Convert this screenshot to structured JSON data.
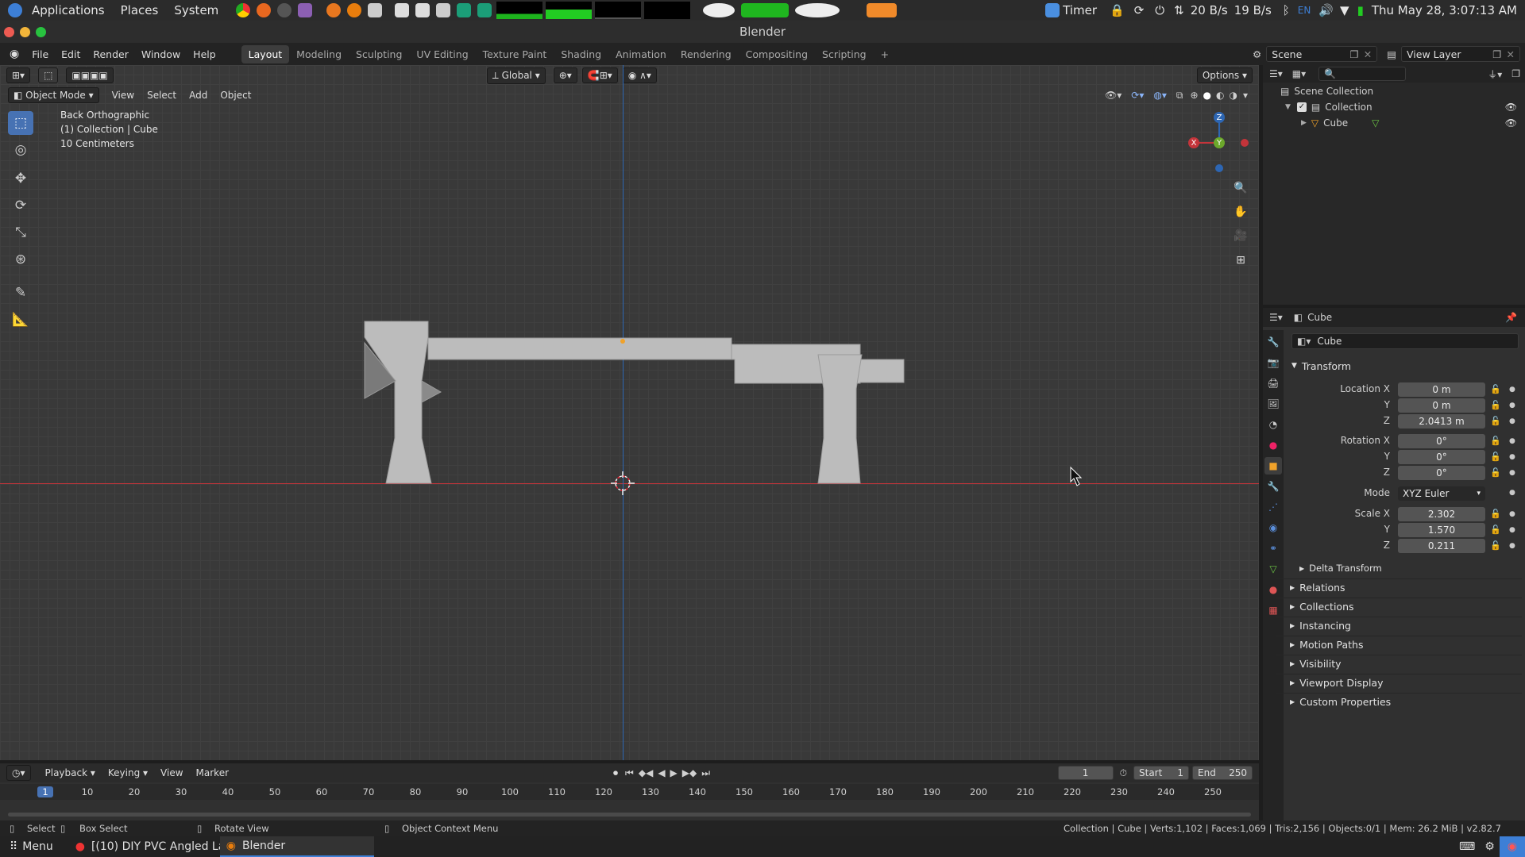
{
  "system_panel": {
    "menus": [
      "Applications",
      "Places",
      "System"
    ],
    "timer_label": "Timer",
    "net_down": "20 B/s",
    "net_up": "19 B/s",
    "lang": "EN",
    "datetime": "Thu May 28, 3:07:13 AM"
  },
  "window": {
    "title": "Blender"
  },
  "topbar": {
    "menus": [
      "File",
      "Edit",
      "Render",
      "Window",
      "Help"
    ],
    "workspaces": [
      "Layout",
      "Modeling",
      "Sculpting",
      "UV Editing",
      "Texture Paint",
      "Shading",
      "Animation",
      "Rendering",
      "Compositing",
      "Scripting"
    ],
    "active_workspace": "Layout",
    "add_tab": "+",
    "scene_label": "Scene",
    "view_layer_label": "View Layer"
  },
  "viewport": {
    "mode": "Object Mode",
    "menus": [
      "View",
      "Select",
      "Add",
      "Object"
    ],
    "orientation": "Global",
    "options": "Options",
    "overlay": {
      "view_name": "Back Orthographic",
      "collection_info": "(1) Collection | Cube",
      "grid_scale": "10 Centimeters"
    },
    "gizmo": {
      "x": "X",
      "y": "Y",
      "z": "Z"
    },
    "colors": {
      "background": "#393939",
      "x_axis": "#c4343a",
      "z_axis": "#2d66b3",
      "mesh": "#bcbcbc"
    }
  },
  "outliner": {
    "search_placeholder": "",
    "items": [
      {
        "label": "Scene Collection"
      },
      {
        "label": "Collection"
      },
      {
        "label": "Cube"
      }
    ]
  },
  "properties": {
    "header_object": "Cube",
    "object_name": "Cube",
    "transform_label": "Transform",
    "location": {
      "label_x": "Location X",
      "label_y": "Y",
      "label_z": "Z",
      "x": "0 m",
      "y": "0 m",
      "z": "2.0413 m"
    },
    "rotation": {
      "label_x": "Rotation X",
      "label_y": "Y",
      "label_z": "Z",
      "x": "0°",
      "y": "0°",
      "z": "0°"
    },
    "mode": {
      "label": "Mode",
      "value": "XYZ Euler"
    },
    "scale": {
      "label_x": "Scale X",
      "label_y": "Y",
      "label_z": "Z",
      "x": "2.302",
      "y": "1.570",
      "z": "0.211"
    },
    "subpanels": [
      "Delta Transform",
      "Relations",
      "Collections",
      "Instancing",
      "Motion Paths",
      "Visibility",
      "Viewport Display",
      "Custom Properties"
    ]
  },
  "timeline": {
    "menus": [
      "Playback",
      "Keying",
      "View",
      "Marker"
    ],
    "current_frame": "1",
    "start_label": "Start",
    "start": "1",
    "end_label": "End",
    "end": "250",
    "ruler": [
      "1",
      "10",
      "20",
      "30",
      "40",
      "50",
      "60",
      "70",
      "80",
      "90",
      "100",
      "110",
      "120",
      "130",
      "140",
      "150",
      "160",
      "170",
      "180",
      "190",
      "200",
      "210",
      "220",
      "230",
      "240",
      "250"
    ]
  },
  "statusbar": {
    "select": "Select",
    "box_select": "Box Select",
    "rotate_view": "Rotate View",
    "context_menu": "Object Context Menu",
    "stats": "Collection | Cube | Verts:1,102 | Faces:1,069 | Tris:2,156 | Objects:0/1 | Mem: 26.2 MiB | v2.82.7"
  },
  "taskbar": {
    "menu": "Menu",
    "items": [
      "[(10) DIY PVC Angled La...",
      "Blender"
    ]
  }
}
